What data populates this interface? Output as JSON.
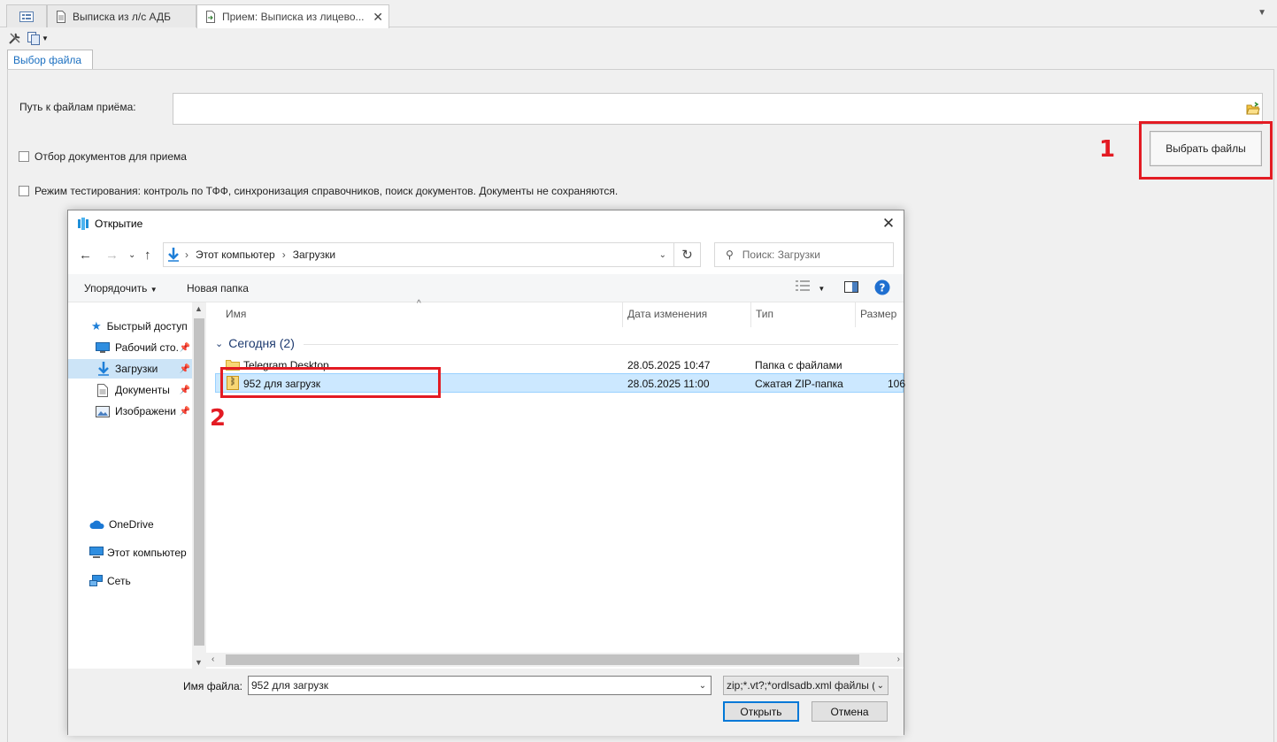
{
  "tabs": [
    {
      "label": ""
    },
    {
      "label": "Выписка из л/с АДБ"
    },
    {
      "label": "Прием: Выписка из лицево..."
    }
  ],
  "panel": {
    "subtab_label": "Выбор файла",
    "path_label": "Путь к файлам приёма:",
    "path_value": "",
    "filter_checkbox_label": "Отбор документов для приема",
    "test_checkbox_label": "Режим тестирования: контроль по ТФФ, синхронизация справочников, поиск документов. Документы не сохраняются.",
    "pick_button_label": "Выбрать файлы"
  },
  "annotations": {
    "step1": "1",
    "step2": "2",
    "color": "#e31b23"
  },
  "dialog": {
    "title": "Открытие",
    "breadcrumb": [
      "Этот компьютер",
      "Загрузки"
    ],
    "search_placeholder": "Поиск: Загрузки",
    "organize_label": "Упорядочить",
    "new_folder_label": "Новая папка",
    "nav_items": [
      {
        "label": "Быстрый доступ",
        "icon": "star-icon"
      },
      {
        "label": "Рабочий сто.",
        "icon": "desktop-icon"
      },
      {
        "label": "Загрузки",
        "icon": "download-icon"
      },
      {
        "label": "Документы",
        "icon": "document-icon"
      },
      {
        "label": "Изображени",
        "icon": "image-icon"
      },
      {
        "label": "OneDrive",
        "icon": "cloud-icon"
      },
      {
        "label": "Этот компьютер",
        "icon": "computer-icon"
      },
      {
        "label": "Сеть",
        "icon": "network-icon"
      }
    ],
    "columns": {
      "name": "Имя",
      "date": "Дата изменения",
      "type": "Тип",
      "size": "Размер"
    },
    "group_label": "Сегодня (2)",
    "files": [
      {
        "name": "Telegram Desktop",
        "date": "28.05.2025 10:47",
        "type": "Папка с файлами",
        "size": "",
        "icon": "folder-icon"
      },
      {
        "name": "952 для загрузк",
        "date": "28.05.2025 11:00",
        "type": "Сжатая ZIP-папка",
        "size": "106",
        "icon": "zip-folder-icon"
      }
    ],
    "filename_label": "Имя файла:",
    "filename_value": "952 для загрузк",
    "filter_value": "zip;*.vt?;*ordlsadb.xml файлы (",
    "open_label": "Открыть",
    "cancel_label": "Отмена"
  }
}
